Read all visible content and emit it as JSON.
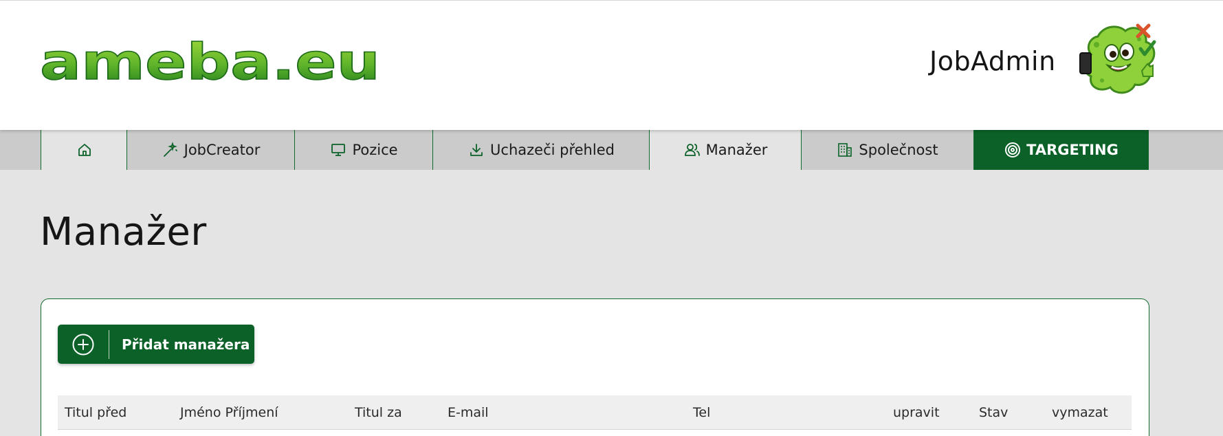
{
  "header": {
    "logo_text": "ameba.eu",
    "app_name": "JobAdmin"
  },
  "nav": {
    "tabs": [
      {
        "label": "",
        "icon": "home-icon"
      },
      {
        "label": "JobCreator",
        "icon": "magic-wand-icon"
      },
      {
        "label": "Pozice",
        "icon": "monitor-icon"
      },
      {
        "label": "Uchazeči přehled",
        "icon": "download-icon"
      },
      {
        "label": "Manažer",
        "icon": "users-icon",
        "active": true
      },
      {
        "label": "Společnost",
        "icon": "building-icon"
      },
      {
        "label": "TARGETING",
        "icon": "target-icon"
      }
    ]
  },
  "page": {
    "title": "Manažer",
    "add_button_label": "Přidat manažera"
  },
  "table": {
    "columns": [
      "Titul před",
      "Jméno Příjmení",
      "Titul za",
      "E-mail",
      "Tel",
      "upravit",
      "Stav",
      "vymazat"
    ]
  },
  "colors": {
    "brand_dark_green": "#0b6128",
    "logo_green": "#5db82c",
    "background": "#e4e4e4",
    "nav_background": "#cbcbcb"
  }
}
